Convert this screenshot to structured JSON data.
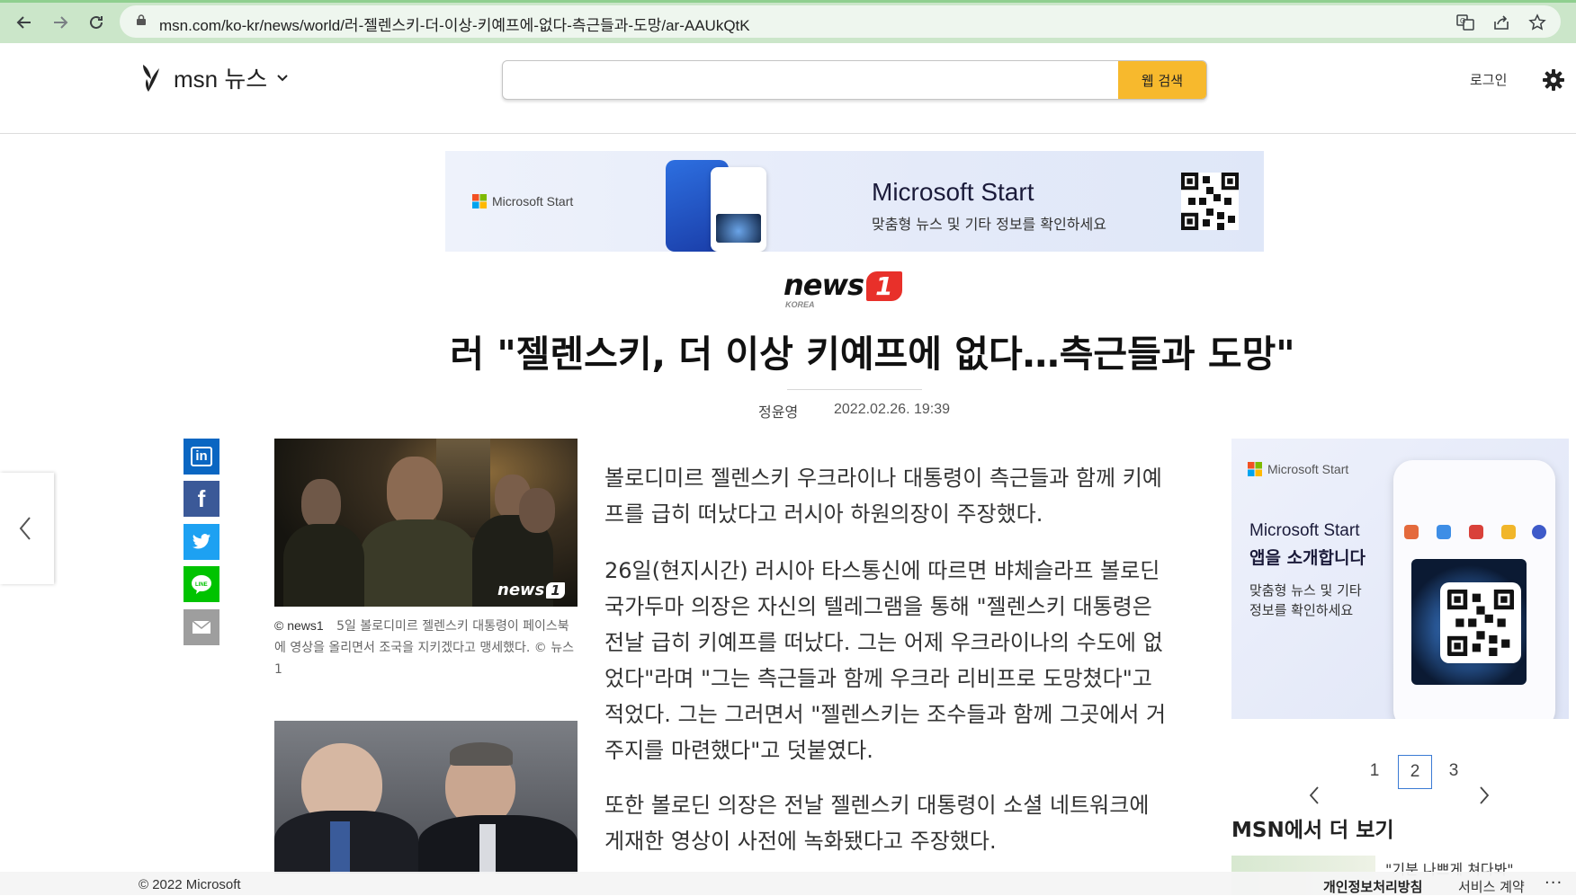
{
  "browser": {
    "url": "msn.com/ko-kr/news/world/러-젤렌스키-더-이상-키예프에-없다-측근들과-도망/ar-AAUkQtK"
  },
  "header": {
    "brand": "msn 뉴스",
    "search_button": "웹 검색",
    "search_placeholder": "",
    "login": "로그인"
  },
  "banner": {
    "brand": "Microsoft Start",
    "headline": "Microsoft Start",
    "subline": "맞춤형 뉴스 및 기타 정보를 확인하세요"
  },
  "article": {
    "publisher": "news",
    "publisher_num": "1",
    "publisher_sub": "KOREA",
    "title": "러 \"젤렌스키, 더 이상 키예프에 없다…측근들과 도망\"",
    "author": "정윤영",
    "date": "2022.02.26. 19:39",
    "image1_watermark": "news",
    "image1_watermark_num": "1",
    "caption_source": "© news1",
    "caption": "5일 볼로디미르 젤렌스키 대통령이 페이스북에 영상을 올리면서 조국을 지키겠다고 맹세했다. © 뉴스1",
    "paragraphs": [
      "볼로디미르 젤렌스키 우크라이나 대통령이 측근들과 함께 키예프를 급히 떠났다고 러시아 하원의장이 주장했다.",
      "26일(현지시간) 러시아 타스통신에 따르면 뱌체슬라프 볼로딘 국가두마 의장은 자신의 텔레그램을 통해 \"젤렌스키 대통령은 전날 급히 키예프를 떠났다. 그는 어제 우크라이나의 수도에 없었다\"라며 \"그는 측근들과 함께 우크라 리비프로 도망쳤다\"고 적었다. 그는 그러면서 \"젤렌스키는 조수들과 함께 그곳에서 거주지를 마련했다\"고 덧붙였다.",
      "또한 볼로딘 의장은 전날 젤렌스키 대통령이 소셜 네트워크에 게재한 영상이 사전에 녹화됐다고 주장했다."
    ]
  },
  "share": {
    "linkedin": "in",
    "facebook": "f"
  },
  "right_ad": {
    "brand": "Microsoft Start",
    "headline_line1": "Microsoft Start",
    "headline_line2": "앱을 소개합니다",
    "sub_line1": "맞춤형 뉴스 및 기타",
    "sub_line2": "정보를 확인하세요",
    "pager": [
      "1",
      "2",
      "3"
    ],
    "active_page": "2"
  },
  "more": {
    "title": "MSN에서 더 보기",
    "item_text": "\"기분 나쁘게 쳐다봐\""
  },
  "footer": {
    "copyright": "© 2022 Microsoft",
    "privacy": "개인정보처리방침",
    "terms": "서비스 계약",
    "more": "···"
  },
  "colors": {
    "chrome_bg": "#cbe6c9",
    "search_button": "#f7b92d",
    "news1_red": "#e8302a",
    "linkedin": "#0a66c2",
    "facebook": "#3b5998",
    "twitter": "#1da1f2",
    "line": "#00c300",
    "email": "#9e9e9e"
  }
}
